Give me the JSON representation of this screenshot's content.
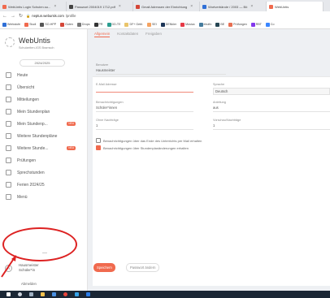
{
  "browser": {
    "tabs": [
      {
        "label": "WebUntis Login Schulen.su...",
        "color": "#f06a4e",
        "active": false
      },
      {
        "label": "Passwort 2004019 1712.pdf",
        "color": "#444444",
        "active": false
      },
      {
        "label": "Gmail Adressen der Einrichtung",
        "color": "#d44638",
        "active": false
      },
      {
        "label": "Wortverbände / 2003 — Bö",
        "color": "#2f6fd6",
        "active": false
      },
      {
        "label": "WebUntis",
        "color": "#f06a4e",
        "active": true
      }
    ],
    "url_host": "neptun.webuntis.com",
    "url_path": "/profile",
    "bookmarks": [
      "Werkstufe",
      "Studi",
      "SO-HPP",
      "Guten",
      "Drops",
      "PR",
      "DD-TE",
      "DF+ Gebl.",
      "SEI",
      "DENkler",
      "Musica",
      "ebulfo",
      "BE",
      "Prüfungen",
      "RBT",
      "Co"
    ]
  },
  "sidebar": {
    "brand_name": "WebUntis",
    "brand_sub": "Schulzeiten-IGS Bramsch",
    "year": "2024/2025",
    "items": [
      {
        "label": "Heute",
        "badge": ""
      },
      {
        "label": "Übersicht",
        "badge": ""
      },
      {
        "label": "Mitteilungen",
        "badge": ""
      },
      {
        "label": "Mein Stundenplan",
        "badge": ""
      },
      {
        "label": "Mein Stundenp...",
        "badge": "NEU"
      },
      {
        "label": "Weitere Stundenpläne",
        "badge": ""
      },
      {
        "label": "Weitere Stunde...",
        "badge": "NEU"
      },
      {
        "label": "Prüfungen",
        "badge": ""
      },
      {
        "label": "Sprechstunden",
        "badge": ""
      },
      {
        "label": "Ferien 2024/25",
        "badge": ""
      },
      {
        "label": "Menü",
        "badge": ""
      }
    ],
    "user_initial": "H",
    "user_name_line1": "Hausmeister",
    "user_name_line2": "Schüler*in",
    "logout": "Abmelden"
  },
  "main": {
    "tabs": [
      "Allgemein",
      "Kontaktdaten",
      "Freigaben"
    ],
    "fields": {
      "benutzer_label": "Benutzer",
      "benutzer_value": "Hausmeister",
      "email_label": "E-Mail Adresse",
      "email_value": "",
      "sprache_label": "Sprache",
      "sprache_value": "Deutsch",
      "benachrichtigungen_label": "Benachrichtigungen",
      "benachrichtigungen_value": "Schüler*innen",
      "anleitung_label": "Anleitung",
      "anleitung_value": "aus",
      "ohne_label": "Ohne Nachträge",
      "ohne_value": "1",
      "vorschau_label": "Vorschau/Nachträge",
      "vorschau_value": "1"
    },
    "checkboxes": [
      {
        "label": "Benachrichtigungen über das Ende des Unterrichts per Mail erhalten",
        "checked": false
      },
      {
        "label": "Benachrichtigungen über Stundenplanänderungen erhalten",
        "checked": true
      }
    ],
    "save_button": "Speichern",
    "password_button": "Passwort ändern"
  },
  "colors": {
    "accent": "#f06a4e",
    "annotation": "#dd2222",
    "taskbar": "#1b2735"
  }
}
